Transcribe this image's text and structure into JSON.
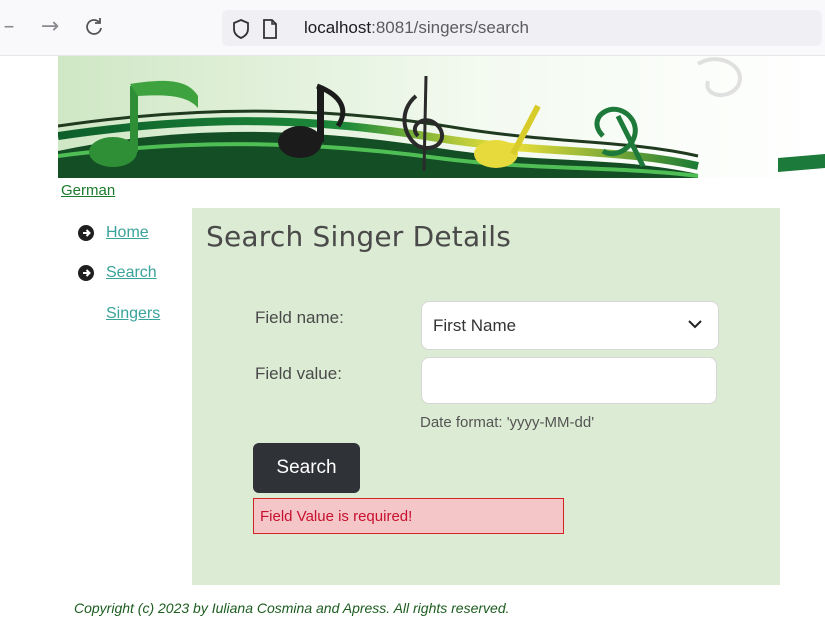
{
  "browser": {
    "url_host": "localhost",
    "url_rest": ":8081/singers/search"
  },
  "header": {
    "language_link": "German"
  },
  "menu": {
    "items": [
      {
        "label": "Home"
      },
      {
        "label": "Search"
      },
      {
        "label": "Singers"
      }
    ]
  },
  "main": {
    "title": "Search Singer Details",
    "field_name_label": "Field name:",
    "field_name_selected": "First Name",
    "field_value_label": "Field value:",
    "field_value": "",
    "date_hint": "Date format: 'yyyy-MM-dd'",
    "search_button": "Search",
    "error_message": "Field Value is required!"
  },
  "footer": {
    "text": "Copyright (c) 2023 by Iuliana Cosmina and Apress. All rights reserved."
  },
  "colors": {
    "panel_bg": "#dcebd3",
    "link_green": "#1c7a2c",
    "menu_link": "#3aa39b",
    "button_dark": "#2f3237",
    "error_red": "#c8102e",
    "error_bg": "#f4c6c8",
    "footer_green": "#1c5d1f"
  }
}
